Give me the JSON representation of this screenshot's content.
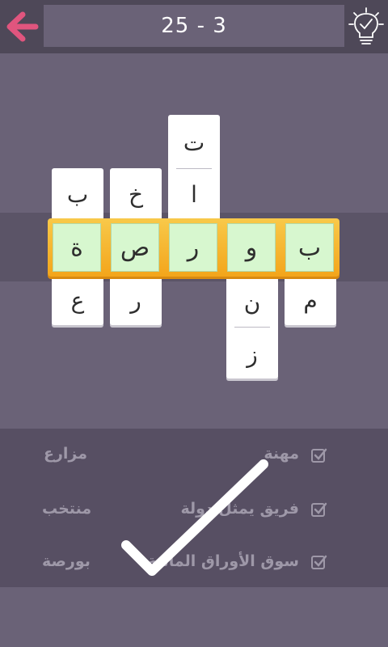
{
  "header": {
    "back_icon": "back-arrow-icon",
    "level": "25 - 3",
    "hint_icon": "lightbulb-check-icon",
    "accent": "#e0557e"
  },
  "answer_word": [
    "ب",
    "و",
    "ر",
    "ص",
    "ة"
  ],
  "columns": [
    {
      "above": [
        "ب"
      ],
      "below": [
        "ع"
      ]
    },
    {
      "above": [
        "خ"
      ],
      "below": [
        "ر"
      ]
    },
    {
      "above": [
        "ت",
        "ا"
      ],
      "below": []
    },
    {
      "above": [],
      "below": [
        "ن",
        "ز"
      ]
    },
    {
      "above": [],
      "below": [
        "م"
      ]
    }
  ],
  "clues": [
    {
      "clue": "مهنة",
      "answer": "مزارع"
    },
    {
      "clue": "فريق يمثل دولة",
      "answer": "منتخب"
    },
    {
      "clue": "سوق الأوراق المالية",
      "answer": "بورصة"
    }
  ],
  "completed_icon": "big-check-icon",
  "colors": {
    "background": "#6a6277",
    "header": "#4e4858",
    "answer_bar": "#f3a51b",
    "answer_cell": "#d7f7cf",
    "clue_text": "#9e98a8"
  }
}
